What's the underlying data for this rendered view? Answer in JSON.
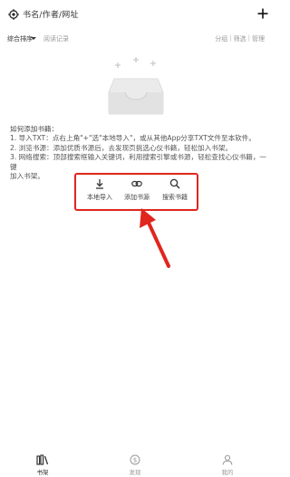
{
  "topbar": {
    "search_placeholder": "书名/作者/网址"
  },
  "sortbar": {
    "sort_label": "综合排序",
    "history_label": "阅读记录",
    "actions": [
      "分组",
      "筛选",
      "管理"
    ],
    "separator": "|"
  },
  "guide": {
    "title": "如何添加书籍：",
    "lines": [
      "1. 导入TXT：点右上角\"+\"选\"本地导入\"，或从其他App分享TXT文件至本软件。",
      "2. 浏览书源：添加优质书源后，去发现页挑选心仪书籍，轻松加入书架。",
      "3. 网络搜索：顶部搜索框输入关键词，利用搜索引擎或书源，轻松查找心仪书籍，一键",
      "加入书架。"
    ]
  },
  "actions": {
    "local_import": "本地导入",
    "add_source": "添加书源",
    "search_books": "搜索书籍"
  },
  "bottom_nav": {
    "bookshelf": "书架",
    "discover": "发现",
    "mine": "我的"
  },
  "colors": {
    "highlight_red": "#e0261e",
    "primary_text": "#333333",
    "secondary_text": "#999999"
  }
}
